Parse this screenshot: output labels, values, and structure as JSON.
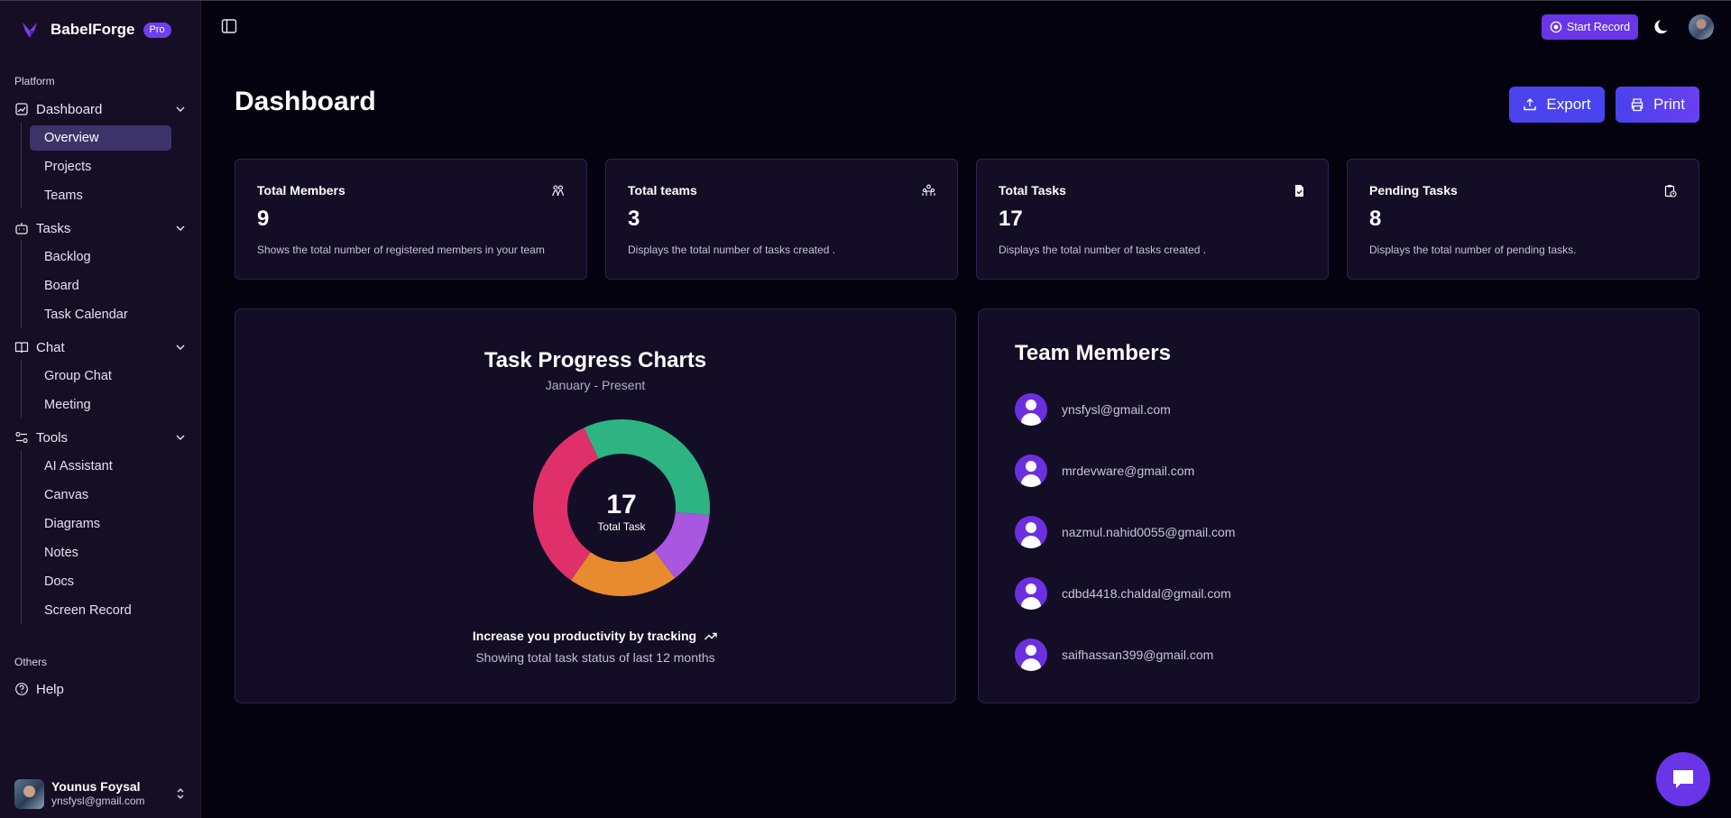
{
  "brand": {
    "name": "BabelForge",
    "badge": "Pro"
  },
  "sidebar": {
    "platform_label": "Platform",
    "groups": [
      {
        "label": "Dashboard",
        "icon": "dashboard-icon",
        "items": [
          "Overview",
          "Projects",
          "Teams"
        ]
      },
      {
        "label": "Tasks",
        "icon": "tasks-icon",
        "items": [
          "Backlog",
          "Board",
          "Task Calendar"
        ]
      },
      {
        "label": "Chat",
        "icon": "book-icon",
        "items": [
          "Group Chat",
          "Meeting"
        ]
      },
      {
        "label": "Tools",
        "icon": "tools-icon",
        "items": [
          "AI Assistant",
          "Canvas",
          "Diagrams",
          "Notes",
          "Docs",
          "Screen Record"
        ]
      }
    ],
    "active_item": "Overview",
    "others_label": "Others",
    "help_label": "Help",
    "user": {
      "name": "Younus Foysal",
      "email": "ynsfysl@gmail.com"
    }
  },
  "topbar": {
    "start_record_label": "Start Record"
  },
  "page": {
    "title": "Dashboard",
    "export_label": "Export",
    "print_label": "Print"
  },
  "stats": [
    {
      "title": "Total Members",
      "value": "9",
      "desc": "Shows the total number of registered members in your team",
      "icon": "users-icon"
    },
    {
      "title": "Total teams",
      "value": "3",
      "desc": "Displays the total number of tasks created .",
      "icon": "team-icon"
    },
    {
      "title": "Total Tasks",
      "value": "17",
      "desc": "Displays the total number of tasks created .",
      "icon": "file-check-icon"
    },
    {
      "title": "Pending Tasks",
      "value": "8",
      "desc": "Displays the total number of pending tasks.",
      "icon": "clipboard-clock-icon"
    }
  ],
  "chart": {
    "title": "Task Progress Charts",
    "subtitle": "January - Present",
    "center_value": "17",
    "center_label": "Total Task",
    "footer_main": "Increase you productivity by tracking",
    "footer_sub": "Showing total task status of last 12 months"
  },
  "chart_data": {
    "type": "pie",
    "title": "Task Progress Charts",
    "subtitle": "January - Present",
    "total": 17,
    "slices": [
      {
        "value": 5,
        "color": "#2db482"
      },
      {
        "value": 2,
        "color": "#a956e0"
      },
      {
        "value": 3,
        "color": "#e78b2e"
      },
      {
        "value": 5,
        "color": "#e0306a"
      }
    ]
  },
  "team": {
    "title": "Team Members",
    "members": [
      "ynsfysl@gmail.com",
      "mrdevware@gmail.com",
      "nazmul.nahid0055@gmail.com",
      "cdbd4418.chaldal@gmail.com",
      "saifhassan399@gmail.com"
    ]
  }
}
